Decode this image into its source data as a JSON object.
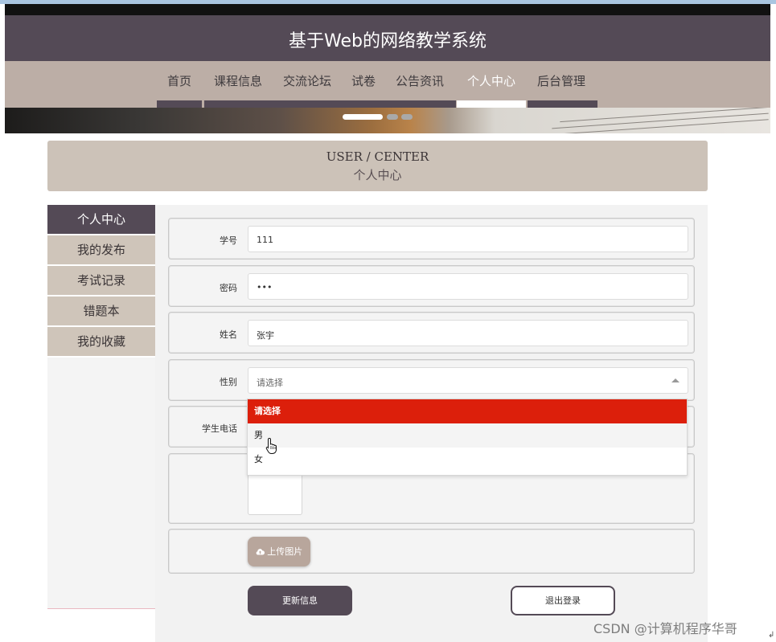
{
  "site": {
    "title": "基于Web的网络教学系统"
  },
  "nav": {
    "items": [
      {
        "label": "首页"
      },
      {
        "label": "课程信息"
      },
      {
        "label": "交流论坛"
      },
      {
        "label": "试卷"
      },
      {
        "label": "公告资讯"
      },
      {
        "label": "个人中心"
      },
      {
        "label": "后台管理"
      }
    ],
    "active_index": 5
  },
  "banner": {
    "slide_count": 3,
    "active_slide": 0
  },
  "page_header": {
    "en": "USER / CENTER",
    "cn": "个人中心"
  },
  "sidebar": {
    "items": [
      {
        "label": "个人中心"
      },
      {
        "label": "我的发布"
      },
      {
        "label": "考试记录"
      },
      {
        "label": "错题本"
      },
      {
        "label": "我的收藏"
      }
    ],
    "active_index": 0
  },
  "form": {
    "student_id": {
      "label": "学号",
      "value": "111"
    },
    "password": {
      "label": "密码",
      "value": "•••"
    },
    "name": {
      "label": "姓名",
      "value": "张宇"
    },
    "gender": {
      "label": "性别",
      "placeholder": "请选择",
      "options": [
        "请选择",
        "男",
        "女"
      ],
      "highlighted_option": "请选择",
      "hover_option": "男"
    },
    "phone": {
      "label": "学生电话"
    },
    "upload_label": "上传图片",
    "update_label": "更新信息",
    "logout_label": "退出登录"
  },
  "colors": {
    "header_bg": "#544a56",
    "nav_bg": "#bcaea6",
    "selected_option": "#dc1f0b"
  },
  "watermark": "CSDN @计算机程序华哥"
}
